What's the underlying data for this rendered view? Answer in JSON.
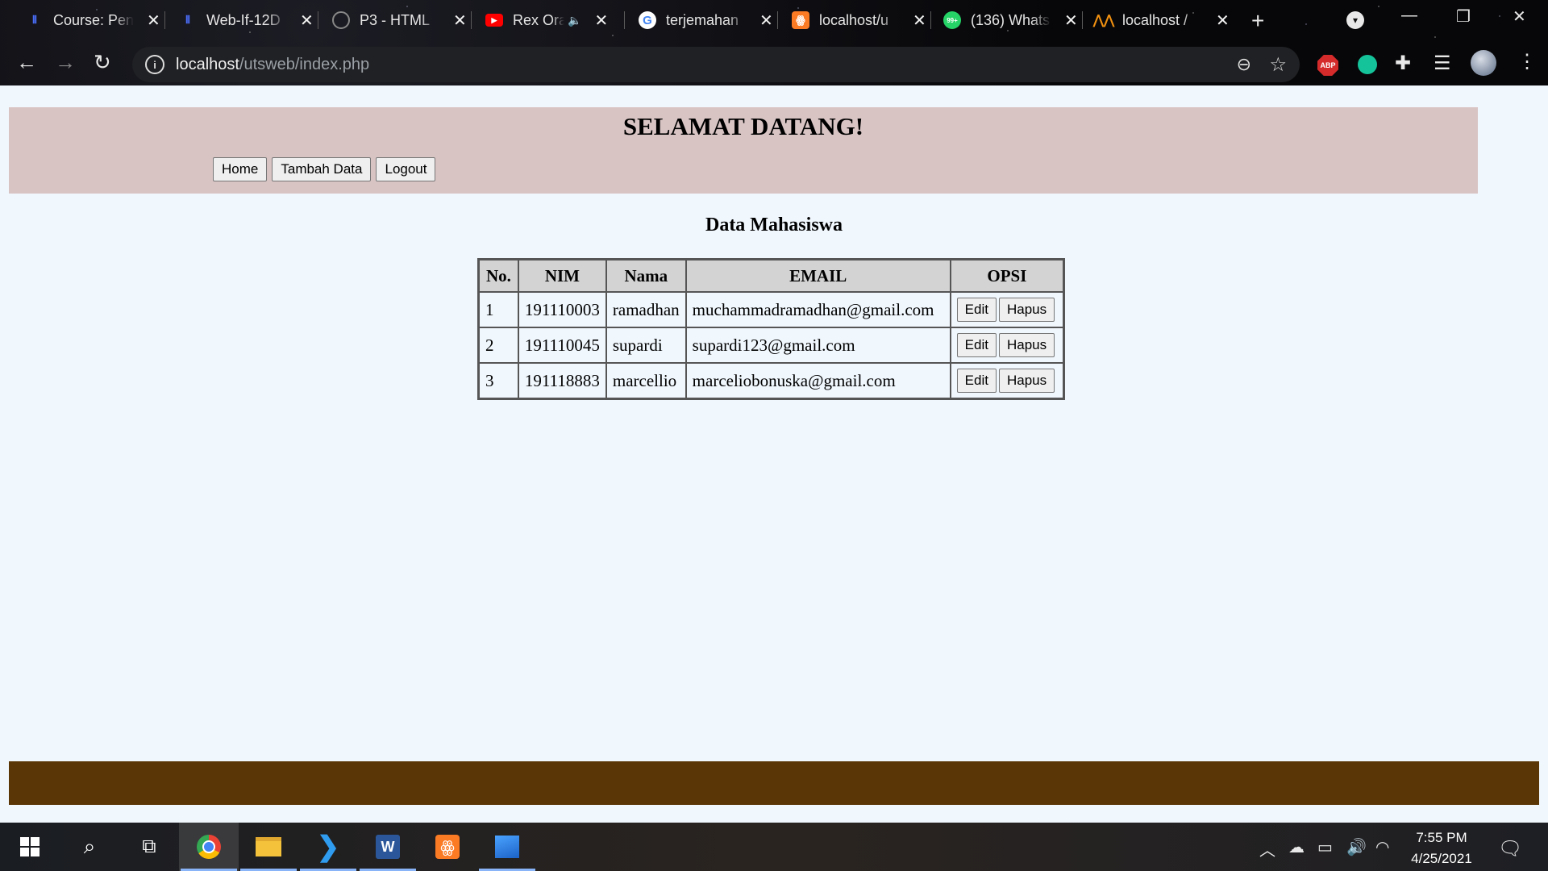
{
  "browser": {
    "tabs": [
      {
        "title": "Course: Pen",
        "icon": "moodle-icon"
      },
      {
        "title": "Web-If-12D",
        "icon": "moodle-icon"
      },
      {
        "title": "P3 - HTML",
        "icon": "globe-icon"
      },
      {
        "title": "Rex Ora",
        "icon": "youtube-icon"
      },
      {
        "title": "terjemahan",
        "icon": "google-icon"
      },
      {
        "title": "localhost/u",
        "icon": "xampp-icon"
      },
      {
        "title": "(136) Whats",
        "icon": "whatsapp-icon"
      },
      {
        "title": "localhost /",
        "icon": "phpmyadmin-icon"
      }
    ],
    "url": {
      "host": "localhost",
      "path": "/utsweb/index.php"
    },
    "abp_label": "ABP"
  },
  "page": {
    "heading": "SELAMAT DATANG!",
    "menu": {
      "home": "Home",
      "add": "Tambah Data",
      "logout": "Logout"
    },
    "subtitle": "Data Mahasiswa",
    "table": {
      "headers": [
        "No.",
        "NIM",
        "Nama",
        "EMAIL",
        "OPSI"
      ],
      "rows": [
        {
          "no": "1",
          "nim": "191110003",
          "nama": "ramadhan",
          "email": "muchammadramadhan@gmail.com"
        },
        {
          "no": "2",
          "nim": "191110045",
          "nama": "supardi",
          "email": "supardi123@gmail.com"
        },
        {
          "no": "3",
          "nim": "191118883",
          "nama": "marcellio",
          "email": "marceliobonuska@gmail.com"
        }
      ],
      "edit_label": "Edit",
      "delete_label": "Hapus"
    },
    "colors": {
      "header_bg": "#d9c4c4",
      "footer_bg": "#5a3606",
      "page_bg": "#f0f7fd"
    }
  },
  "taskbar": {
    "time": "7:55 PM",
    "date": "4/25/2021",
    "apps": [
      "start",
      "search",
      "task-view",
      "chrome",
      "file-explorer",
      "vscode",
      "word",
      "xampp",
      "photos"
    ]
  }
}
